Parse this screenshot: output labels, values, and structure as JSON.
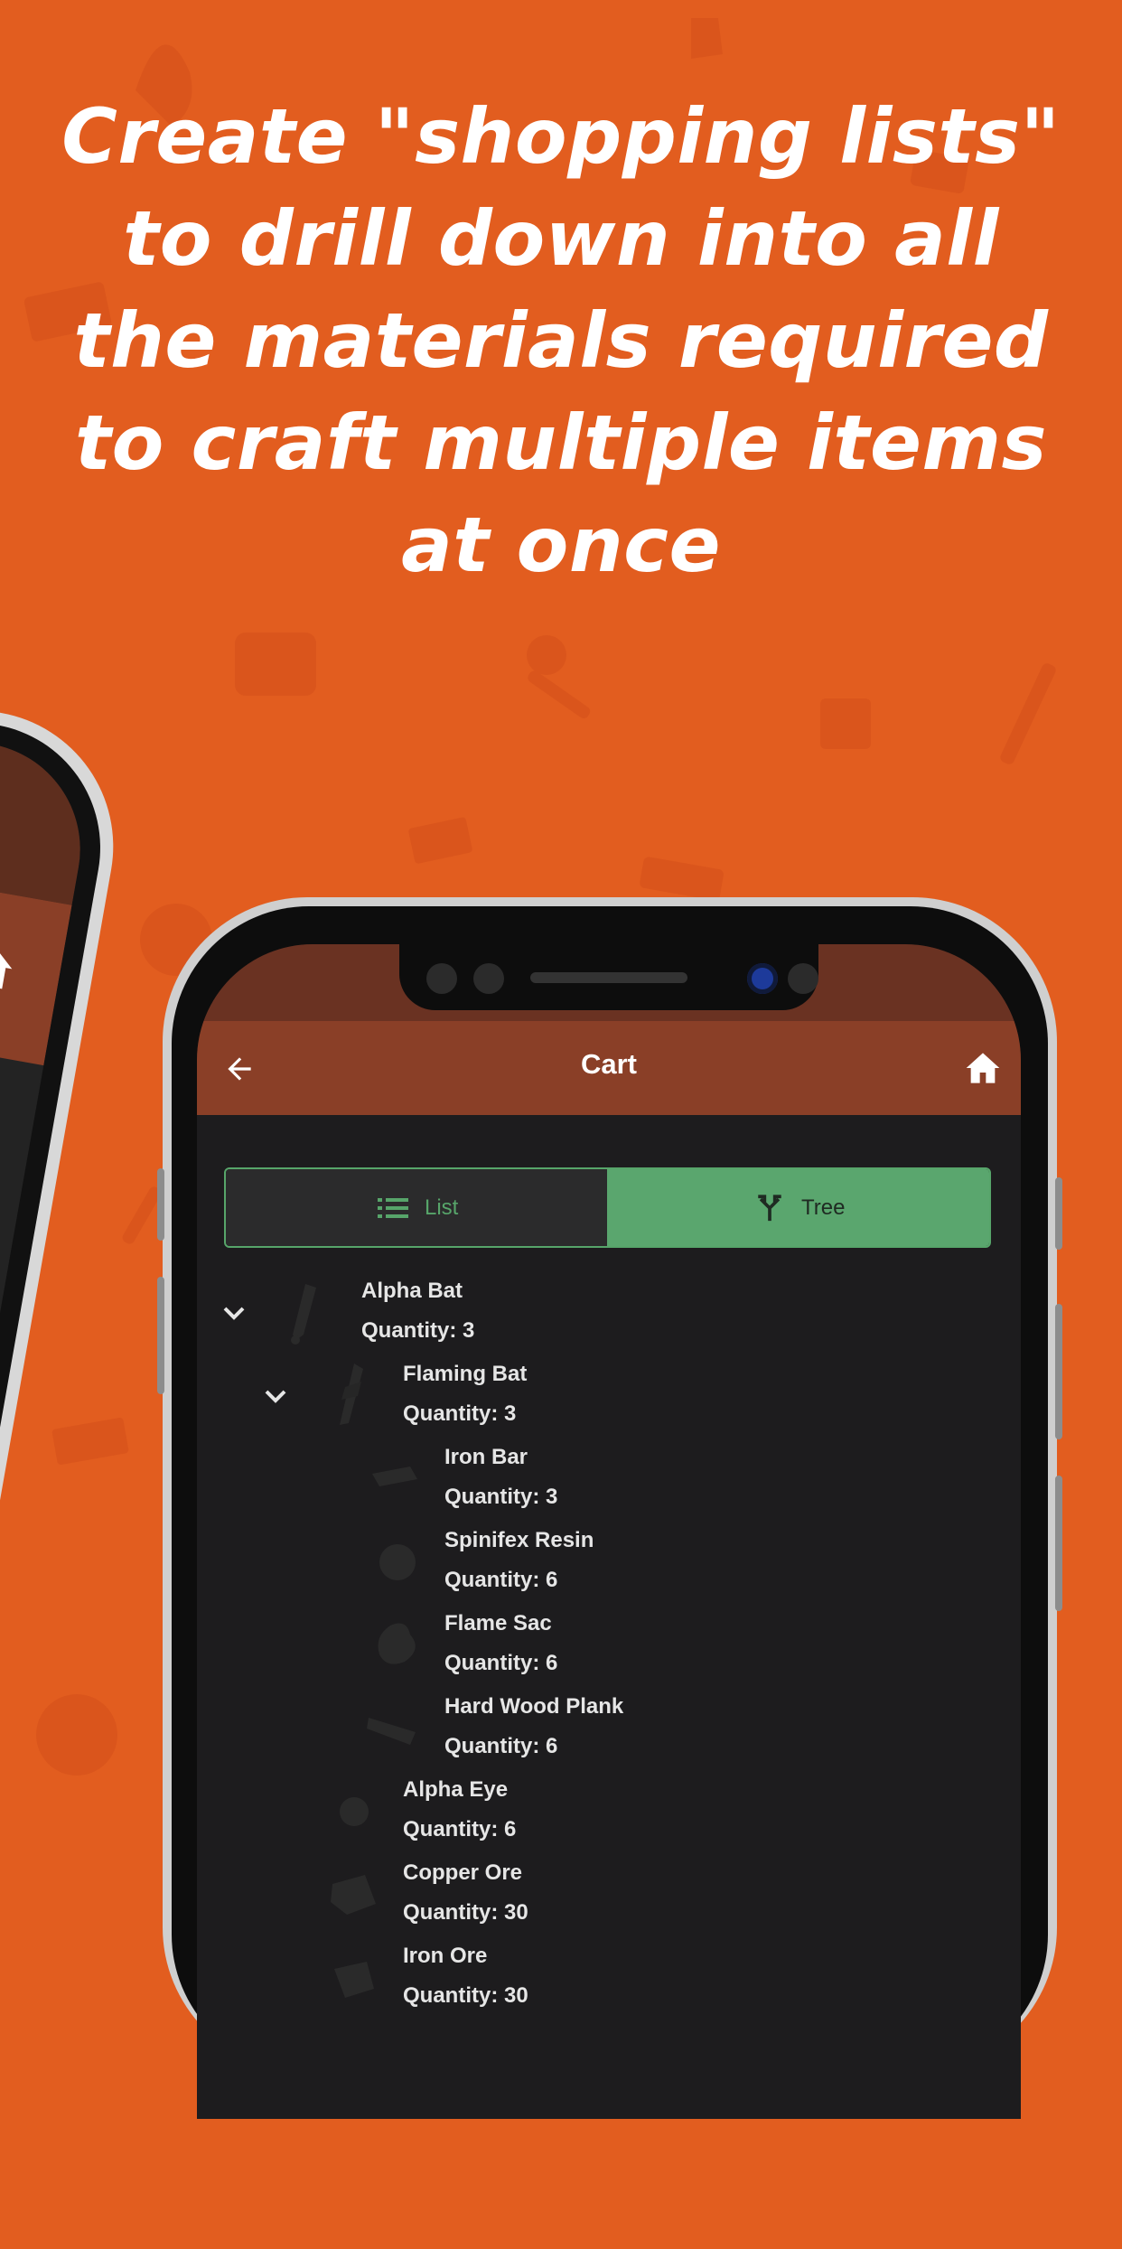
{
  "headline": {
    "lines": [
      "Create \"shopping lists\"",
      "to drill down into all",
      "the materials required",
      "to craft multiple items",
      "at once"
    ]
  },
  "appbar": {
    "title": "Cart",
    "back_icon": "arrow-left-icon",
    "home_icon": "home-icon"
  },
  "view_toggle": {
    "list_label": "List",
    "tree_label": "Tree",
    "selected": "Tree",
    "accent_color": "#5aa66e"
  },
  "tree": {
    "items": [
      {
        "name": "Alpha Bat",
        "quantity": "Quantity: 3",
        "depth": 0,
        "expanded": true
      },
      {
        "name": "Flaming Bat",
        "quantity": "Quantity: 3",
        "depth": 1,
        "expanded": true
      },
      {
        "name": "Iron Bar",
        "quantity": "Quantity: 3",
        "depth": 2
      },
      {
        "name": "Spinifex Resin",
        "quantity": "Quantity: 6",
        "depth": 2
      },
      {
        "name": "Flame Sac",
        "quantity": "Quantity: 6",
        "depth": 2
      },
      {
        "name": "Hard Wood Plank",
        "quantity": "Quantity: 6",
        "depth": 2
      },
      {
        "name": "Alpha Eye",
        "quantity": "Quantity: 6",
        "depth": 1
      },
      {
        "name": "Copper Ore",
        "quantity": "Quantity: 30",
        "depth": 1
      },
      {
        "name": "Iron Ore",
        "quantity": "Quantity: 30",
        "depth": 1
      }
    ]
  },
  "colors": {
    "background": "#e25d1f",
    "appbar": "#8a3f27",
    "status_bar": "#6a3222",
    "screen": "#1d1c1e"
  }
}
